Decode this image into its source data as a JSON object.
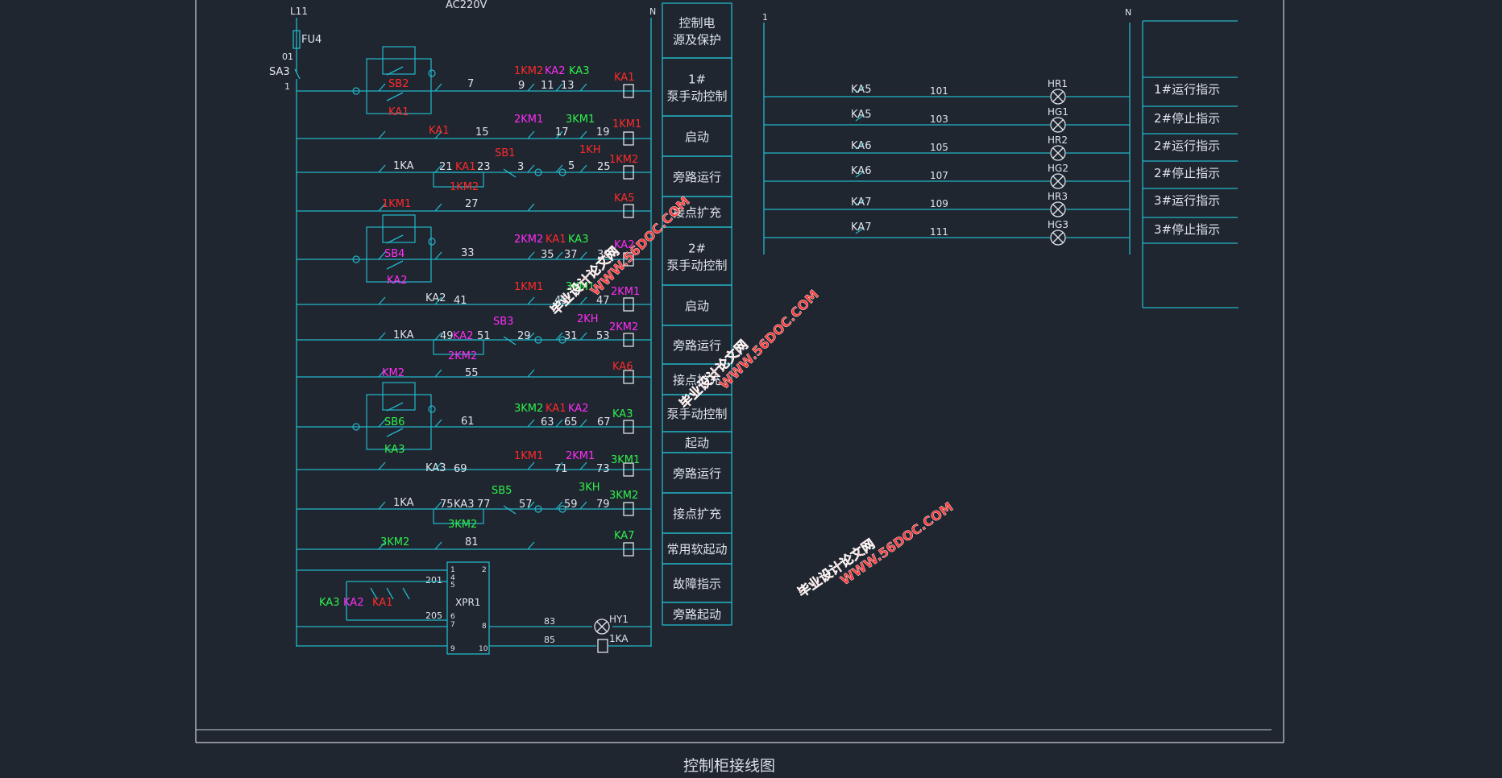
{
  "caption": "控制柜接线图",
  "colors": {
    "background": "#1f2630",
    "wire": "#23b7c9",
    "white_text": "#dfe4ea",
    "red": "#ff2a2a",
    "magenta": "#ff2df5",
    "green": "#2ff04a",
    "frame": "#c9ced6",
    "watermark": "#ff3b3b"
  },
  "header": {
    "supply": "AC220V",
    "phase": "L11",
    "neutral_left": "N",
    "neutral_right": "N",
    "right_bus": "1"
  },
  "fuse": {
    "label": "FU4",
    "node_above": "01",
    "switch": "SA3",
    "node_below": "1"
  },
  "function_boxes": [
    "控制电\n源及保护",
    "1#\n泵手动控制",
    "启动",
    "旁路运行",
    "接点扩充",
    "2#\n泵手动控制",
    "启动",
    "旁路运行",
    "接点扩充",
    "泵手动控制",
    "起动",
    "旁路运行",
    "接点扩充",
    "常用软起动",
    "故障指示",
    "旁路起动"
  ],
  "rungs": [
    {
      "labels": [
        [
          "SB2",
          "red"
        ],
        [
          "KA1",
          "red"
        ],
        [
          "7",
          "white"
        ],
        [
          "1KM2",
          "red"
        ],
        [
          "KA2",
          "magenta"
        ],
        [
          "KA3",
          "green"
        ],
        [
          "9",
          "white"
        ],
        [
          "11",
          "white"
        ],
        [
          "13",
          "white"
        ],
        [
          "KA1",
          "red"
        ]
      ]
    },
    {
      "labels": [
        [
          "KA1",
          "red"
        ],
        [
          "15",
          "white"
        ],
        [
          "2KM1",
          "magenta"
        ],
        [
          "3KM1",
          "green"
        ],
        [
          "17",
          "white"
        ],
        [
          "19",
          "white"
        ],
        [
          "1KM1",
          "red"
        ]
      ]
    },
    {
      "labels": [
        [
          "1KA",
          "white"
        ],
        [
          "21",
          "white"
        ],
        [
          "KA1",
          "red"
        ],
        [
          "23",
          "white"
        ],
        [
          "SB1",
          "red"
        ],
        [
          "3",
          "white"
        ],
        [
          "5",
          "white"
        ],
        [
          "1KH",
          "red"
        ],
        [
          "25",
          "white"
        ],
        [
          "1KM2",
          "red"
        ],
        [
          "1KM2",
          "red"
        ]
      ]
    },
    {
      "labels": [
        [
          "1KM1",
          "red"
        ],
        [
          "27",
          "white"
        ],
        [
          "KA5",
          "red"
        ]
      ]
    },
    {
      "labels": [
        [
          "SB4",
          "magenta"
        ],
        [
          "KA2",
          "magenta"
        ],
        [
          "33",
          "white"
        ],
        [
          "2KM2",
          "magenta"
        ],
        [
          "KA1",
          "red"
        ],
        [
          "KA3",
          "green"
        ],
        [
          "35",
          "white"
        ],
        [
          "37",
          "white"
        ],
        [
          "39",
          "white"
        ],
        [
          "KA2",
          "magenta"
        ]
      ]
    },
    {
      "labels": [
        [
          "KA2",
          "white"
        ],
        [
          "41",
          "white"
        ],
        [
          "1KM1",
          "red"
        ],
        [
          "3KM1",
          "green"
        ],
        [
          "43",
          "white"
        ],
        [
          "47",
          "white"
        ],
        [
          "2KM1",
          "magenta"
        ]
      ]
    },
    {
      "labels": [
        [
          "1KA",
          "white"
        ],
        [
          "49",
          "white"
        ],
        [
          "KA2",
          "magenta"
        ],
        [
          "51",
          "white"
        ],
        [
          "SB3",
          "magenta"
        ],
        [
          "29",
          "white"
        ],
        [
          "31",
          "white"
        ],
        [
          "2KH",
          "magenta"
        ],
        [
          "53",
          "white"
        ],
        [
          "2KM2",
          "magenta"
        ],
        [
          "2KM2",
          "magenta"
        ]
      ]
    },
    {
      "labels": [
        [
          "KM2",
          "magenta"
        ],
        [
          "55",
          "white"
        ],
        [
          "KA6",
          "red"
        ]
      ]
    },
    {
      "labels": [
        [
          "SB6",
          "green"
        ],
        [
          "KA3",
          "green"
        ],
        [
          "61",
          "white"
        ],
        [
          "3KM2",
          "green"
        ],
        [
          "KA1",
          "red"
        ],
        [
          "KA2",
          "magenta"
        ],
        [
          "63",
          "white"
        ],
        [
          "65",
          "white"
        ],
        [
          "67",
          "white"
        ],
        [
          "KA3",
          "green"
        ]
      ]
    },
    {
      "labels": [
        [
          "KA3",
          "white"
        ],
        [
          "69",
          "white"
        ],
        [
          "1KM1",
          "red"
        ],
        [
          "2KM1",
          "magenta"
        ],
        [
          "71",
          "white"
        ],
        [
          "73",
          "white"
        ],
        [
          "3KM1",
          "green"
        ]
      ]
    },
    {
      "labels": [
        [
          "1KA",
          "white"
        ],
        [
          "75",
          "white"
        ],
        [
          "KA3",
          "white"
        ],
        [
          "77",
          "white"
        ],
        [
          "SB5",
          "green"
        ],
        [
          "57",
          "white"
        ],
        [
          "59",
          "white"
        ],
        [
          "3KH",
          "green"
        ],
        [
          "79",
          "white"
        ],
        [
          "3KM2",
          "green"
        ],
        [
          "3KM2",
          "green"
        ]
      ]
    },
    {
      "labels": [
        [
          "3KM2",
          "green"
        ],
        [
          "81",
          "white"
        ],
        [
          "KA7",
          "green"
        ]
      ]
    }
  ],
  "xpr": {
    "name": "XPR1",
    "pins": [
      "1",
      "4",
      "5",
      "6",
      "7",
      "9",
      "2",
      "8",
      "10"
    ],
    "nodes": [
      "201",
      "205",
      "83",
      "85"
    ],
    "contacts": [
      [
        "KA3",
        "green"
      ],
      [
        "KA2",
        "magenta"
      ],
      [
        "KA1",
        "red"
      ]
    ],
    "lamp": "HY1",
    "relay": "1KA"
  },
  "indicators": [
    {
      "contact": "KA5",
      "node": "101",
      "lamp": "HR1",
      "text": "1#运行指示"
    },
    {
      "contact": "KA5",
      "node": "103",
      "lamp": "HG1",
      "text": "2#停止指示"
    },
    {
      "contact": "KA6",
      "node": "105",
      "lamp": "HR2",
      "text": "2#运行指示"
    },
    {
      "contact": "KA6",
      "node": "107",
      "lamp": "HG2",
      "text": "2#停止指示"
    },
    {
      "contact": "KA7",
      "node": "109",
      "lamp": "HR3",
      "text": "3#运行指示"
    },
    {
      "contact": "KA7",
      "node": "111",
      "lamp": "HG3",
      "text": "3#停止指示"
    }
  ],
  "watermarks": [
    {
      "line1": "毕业设计论文网",
      "line2": "WWW.56DOC.COM"
    },
    {
      "line1": "毕业设计论文网",
      "line2": "WWW.56DOC.COM"
    },
    {
      "line1": "毕业设计论文网",
      "line2": "WWW.56DOC.COM"
    }
  ]
}
